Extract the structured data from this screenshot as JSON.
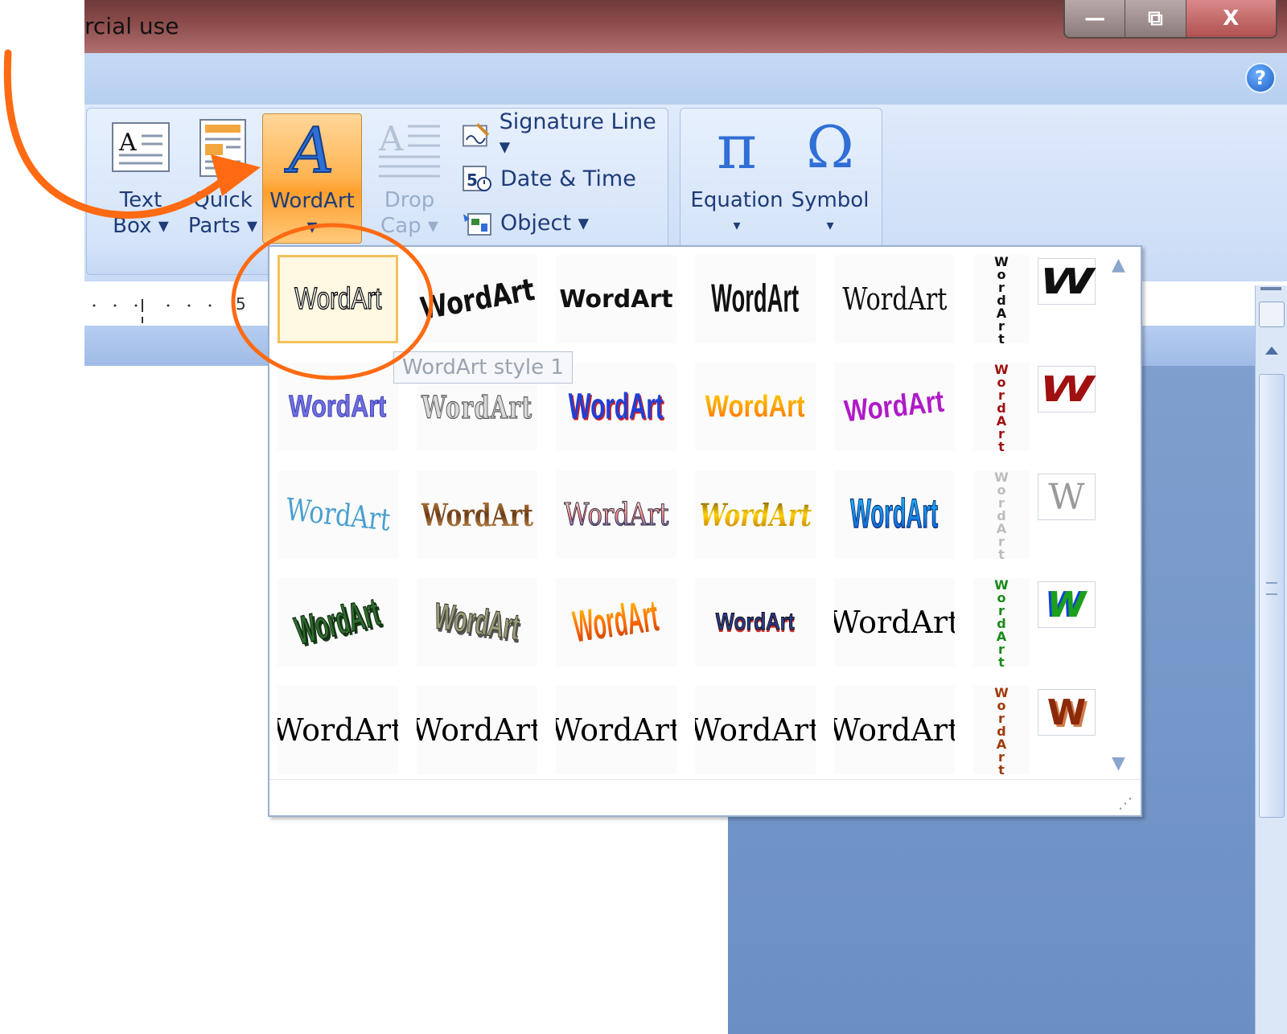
{
  "window": {
    "title_fragment": "rcial use",
    "minimize": "—",
    "restore": "⧉",
    "close": "X",
    "help": "?"
  },
  "ribbon": {
    "text_box": {
      "line1": "Text",
      "line2": "Box ▾"
    },
    "quick_parts": {
      "line1": "Quick",
      "line2": "Parts ▾"
    },
    "wordart": {
      "line1": "WordArt",
      "line2": "▾"
    },
    "drop_cap": {
      "line1": "Drop",
      "line2": "Cap ▾"
    },
    "signature_line": "Signature Line ▾",
    "date_time": "Date & Time",
    "object": "Object ▾",
    "equation": {
      "label": "Equation",
      "arrow": "▾",
      "glyph": "π"
    },
    "symbol": {
      "label": "Symbol",
      "arrow": "▾",
      "glyph": "Ω"
    }
  },
  "ruler": {
    "mark": "5"
  },
  "gallery": {
    "tooltip": "WordArt style 1",
    "sample_text": "WordArt",
    "vertical_text": "WordArt",
    "w_text": "W",
    "scroll_up": "▲",
    "scroll_down": "▼",
    "resize_grip": "⋰"
  },
  "colors": {
    "accent_orange": "#ff6a12",
    "ribbon_text": "#1e3c78"
  }
}
